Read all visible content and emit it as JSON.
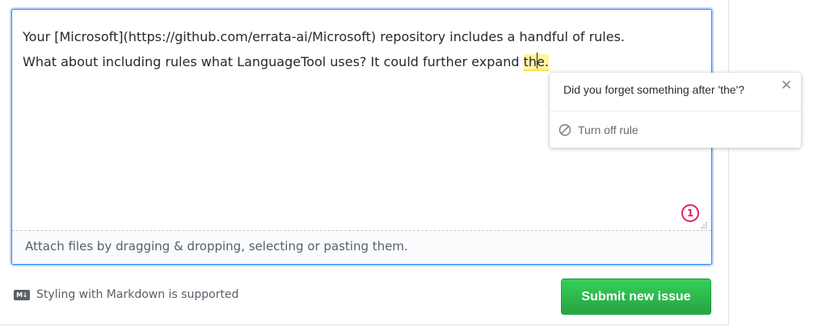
{
  "editor": {
    "line1": "Your [Microsoft](https://github.com/errata-ai/Microsoft) repository includes a handful of rules.",
    "line2_before": "What about including rules what LanguageTool uses? It could further expand ",
    "highlight_part1": "th",
    "highlight_part2": "e.",
    "attach_hint": "Attach files by dragging & dropping, selecting or pasting them.",
    "issue_count": "1"
  },
  "popup": {
    "message": "Did you forget something after 'the'?",
    "action_label": "Turn off rule",
    "close_icon": "close-icon",
    "action_icon": "block-icon"
  },
  "footer": {
    "markdown_note": "Styling with Markdown is supported",
    "markdown_icon_text": "M↓",
    "submit_label": "Submit new issue"
  },
  "colors": {
    "accent": "#2188ff",
    "highlight": "#fff4a0",
    "badge": "#e91e63",
    "submit": "#28a745"
  }
}
